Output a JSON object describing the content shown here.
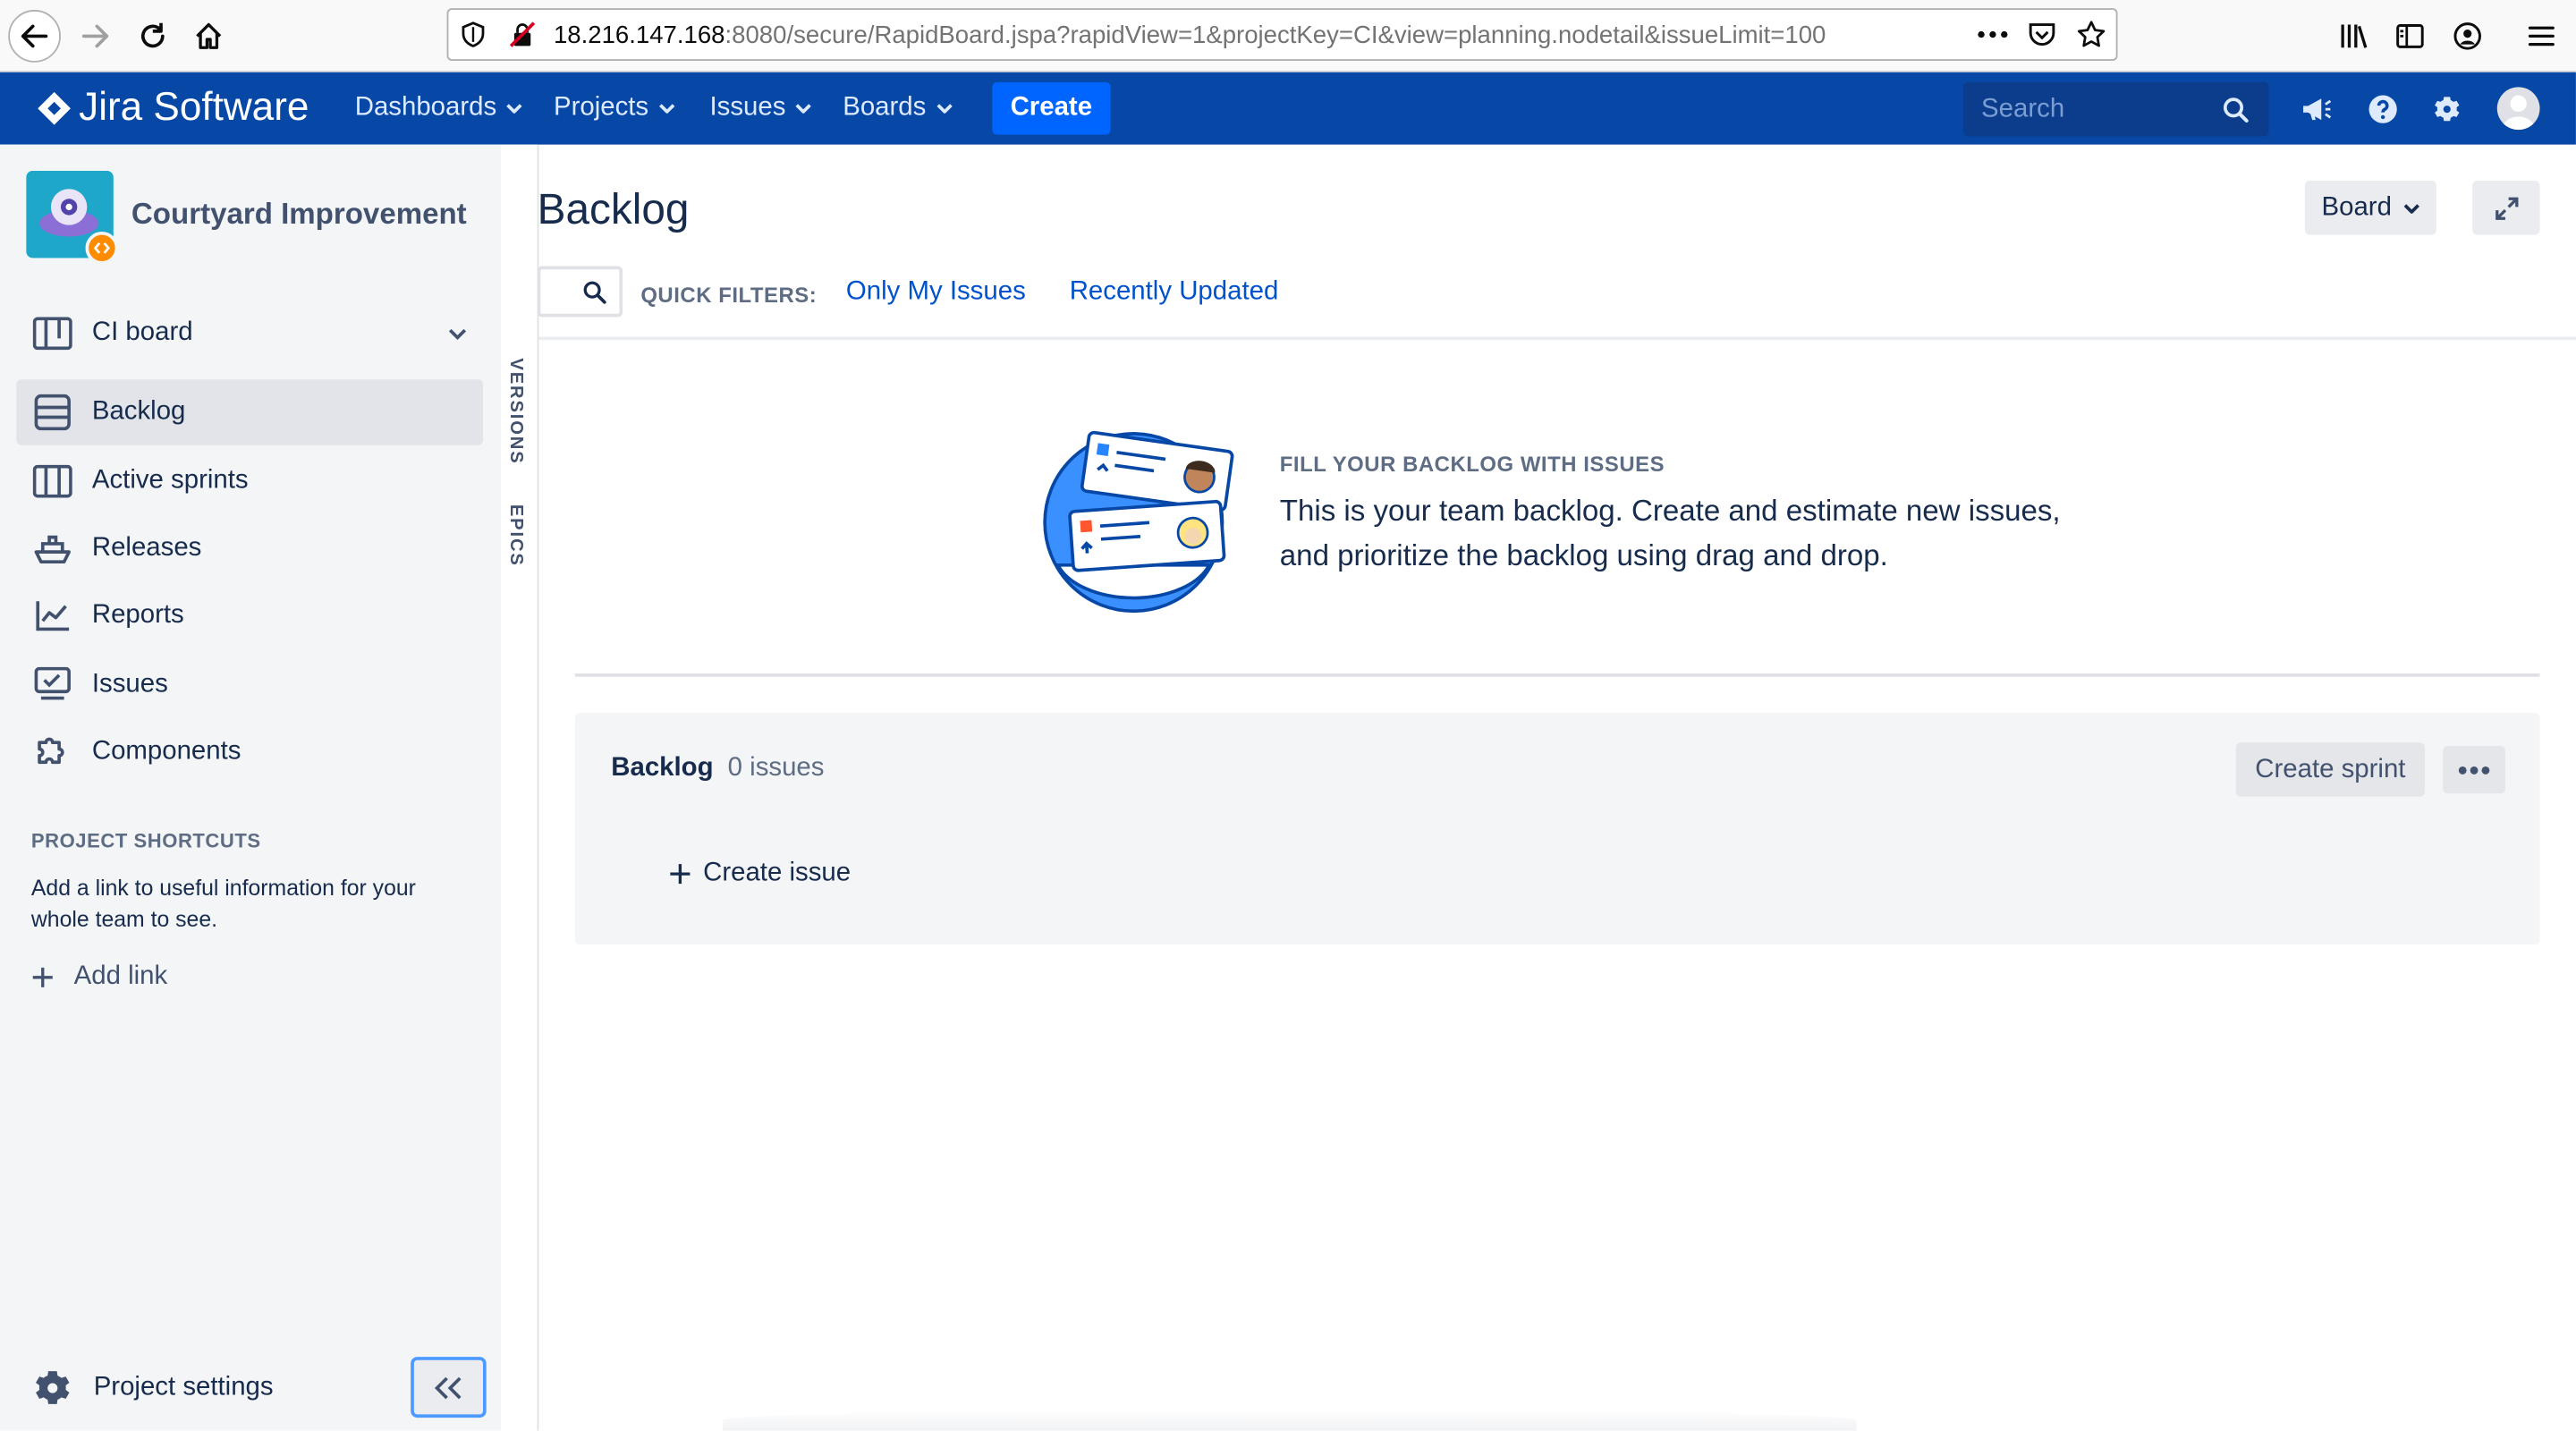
{
  "browser": {
    "url_host": "18.216.147.168",
    "url_path": ":8080/secure/RapidBoard.jspa?rapidView=1&projectKey=CI&view=planning.nodetail&issueLimit=100"
  },
  "topnav": {
    "logo_text": "Jira Software",
    "items": [
      "Dashboards",
      "Projects",
      "Issues",
      "Boards"
    ],
    "create_label": "Create",
    "search_placeholder": "Search"
  },
  "sidebar": {
    "project_name": "Courtyard Improvement",
    "board_selector": "CI board",
    "items": [
      "Backlog",
      "Active sprints",
      "Releases",
      "Reports",
      "Issues",
      "Components"
    ],
    "active_item": "Backlog",
    "shortcuts_heading": "PROJECT SHORTCUTS",
    "shortcuts_text": "Add a link to useful information for your whole team to see.",
    "add_link_label": "Add link",
    "project_settings_label": "Project settings"
  },
  "rail": {
    "versions_label": "VERSIONS",
    "epics_label": "EPICS"
  },
  "main": {
    "title": "Backlog",
    "board_button": "Board",
    "quick_filters_label": "QUICK FILTERS:",
    "filters": [
      "Only My Issues",
      "Recently Updated"
    ],
    "empty_heading": "FILL YOUR BACKLOG WITH ISSUES",
    "empty_text_line1": "This is your team backlog. Create and estimate new issues,",
    "empty_text_line2": "and prioritize the backlog using drag and drop.",
    "backlog_title": "Backlog",
    "backlog_count": "0 issues",
    "create_sprint_label": "Create sprint",
    "create_issue_label": "Create issue"
  },
  "colors": {
    "nav_bg": "#0747a6",
    "create_btn": "#0065ff",
    "link": "#0052cc",
    "sidebar_bg": "#f4f5f7"
  }
}
